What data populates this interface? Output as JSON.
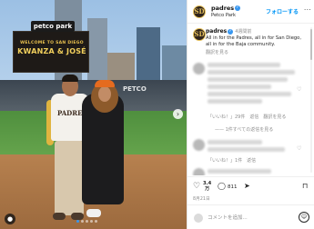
{
  "photo": {
    "board_sign": "petco park",
    "board_welcome": "WELCOME TO SAN DIEGO",
    "board_names": "KWANZA & JOSÉ",
    "stadium_sign": "PETCO",
    "jersey_text": "PADRES"
  },
  "header": {
    "username": "padres",
    "location": "Petco Park",
    "follow_label": "フォローする",
    "more_glyph": "···",
    "verified_glyph": "✓",
    "avatar_glyph": "SD"
  },
  "caption": {
    "username": "padres",
    "time": "4週間前",
    "text": "All in for the Padres, all in for San Diego, all in for the Baja community.",
    "translate": "翻訳を見る"
  },
  "comments": [
    {
      "meta": "「いいね！」29件　返信　翻訳を見る",
      "replies": "—— 1件すべての返信を見る"
    },
    {
      "meta": "「いいね！」1件　返信"
    }
  ],
  "actions": {
    "like_count": "3.4\n万",
    "comment_count": "811",
    "heart": "♡",
    "comment": "◯",
    "share": "➤",
    "save": "⊓"
  },
  "date": "8月21日",
  "comment_input": {
    "placeholder": "コメントを追加..."
  },
  "icons": {
    "heart_small": "♡",
    "emoji": "☺",
    "arrow": "›",
    "user_tag": "👤"
  },
  "colors": {
    "accent": "#0095f6",
    "verified": "#3897f0",
    "padres_gold": "#e6c15b",
    "padres_brown": "#2f241d"
  }
}
